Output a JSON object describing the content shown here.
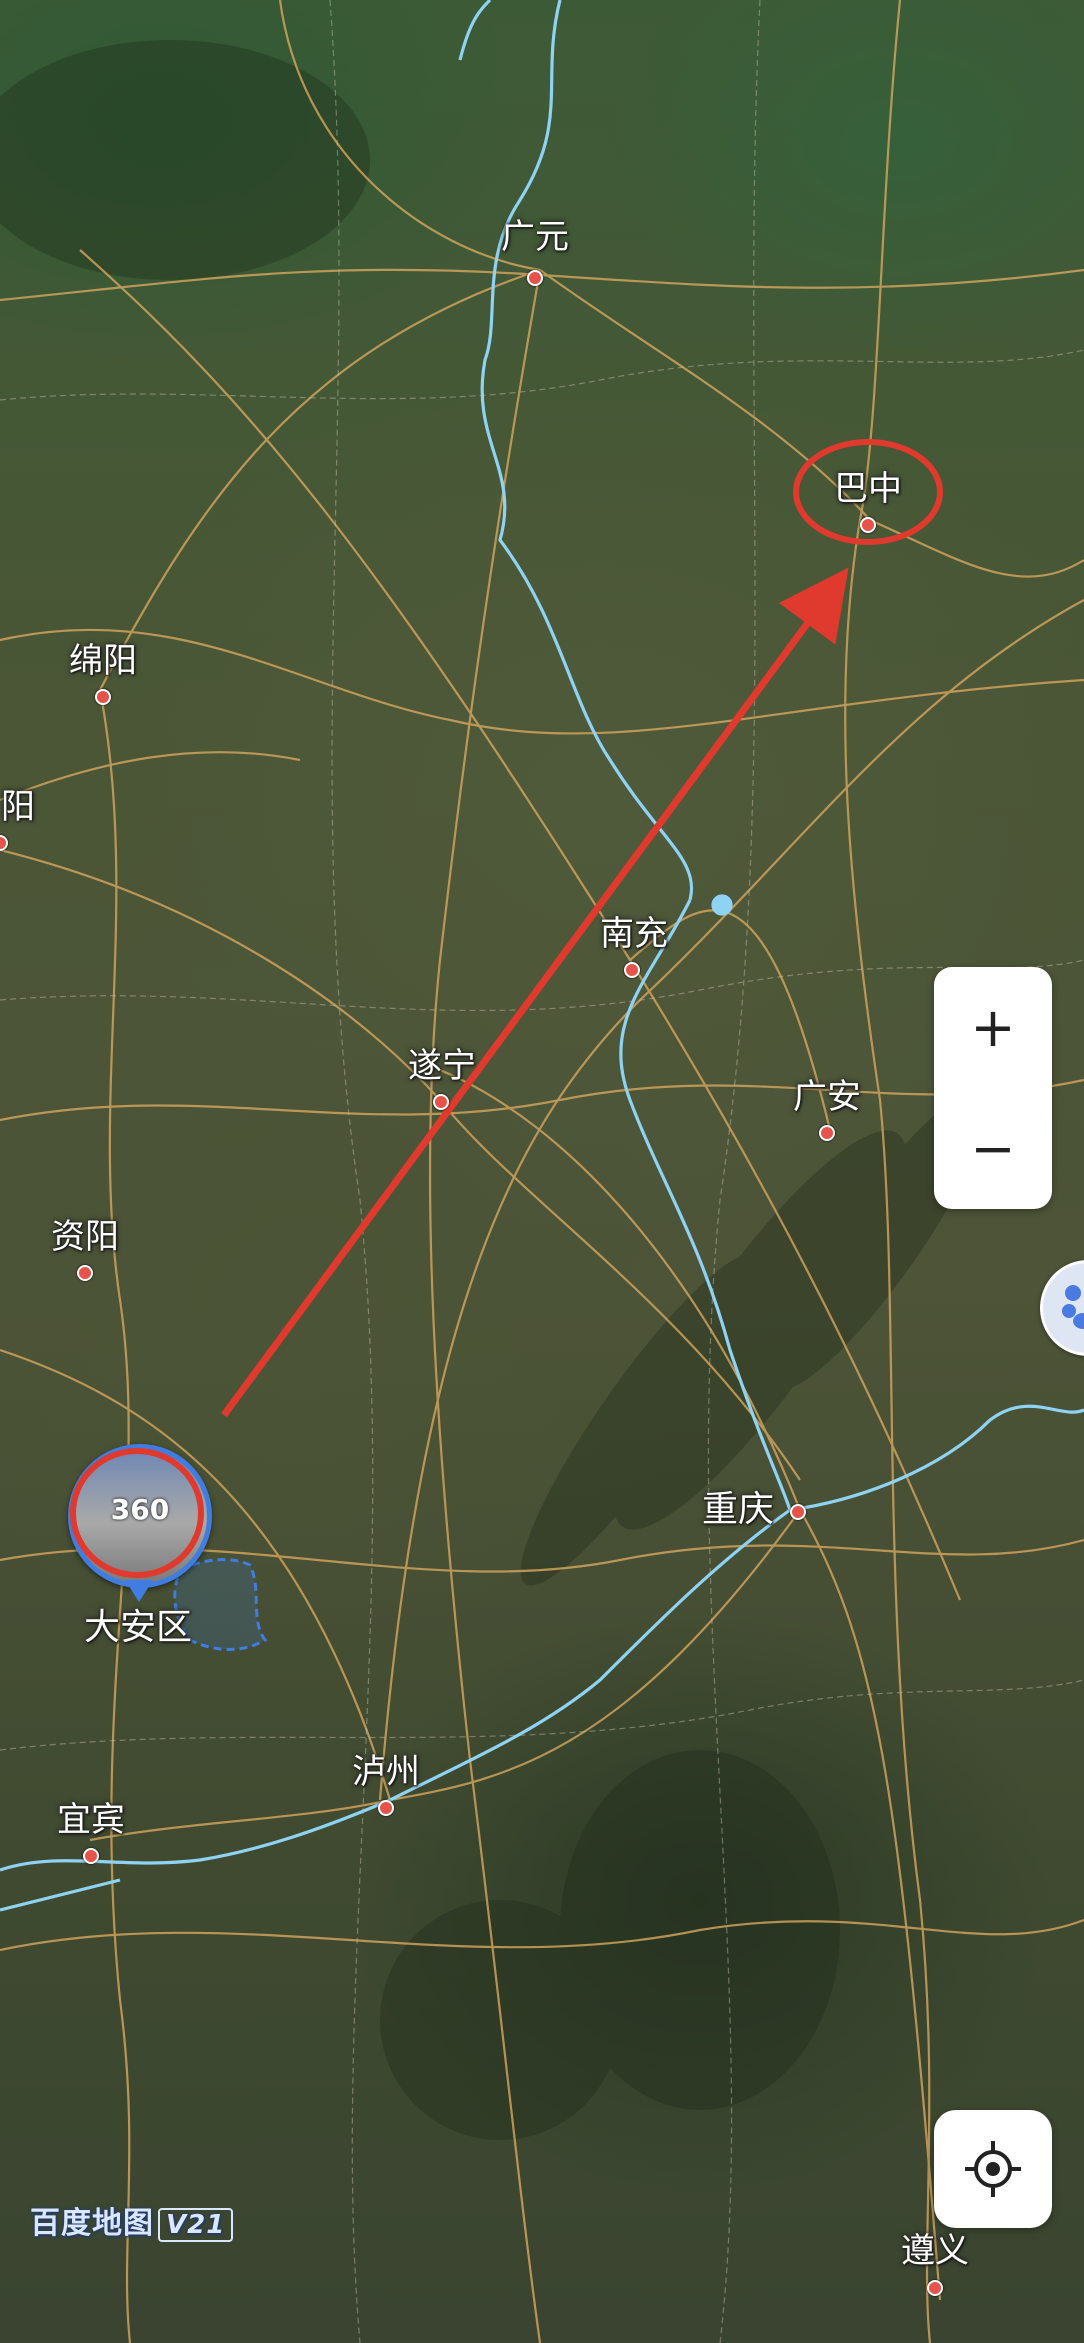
{
  "map": {
    "type": "satellite",
    "cities": [
      {
        "id": "guangyuan",
        "name": "广元"
      },
      {
        "id": "bazhong",
        "name": "巴中"
      },
      {
        "id": "mianyang",
        "name": "绵阳"
      },
      {
        "id": "deyang_partial",
        "name": "阳"
      },
      {
        "id": "nanchong",
        "name": "南充"
      },
      {
        "id": "suining",
        "name": "遂宁"
      },
      {
        "id": "guangan",
        "name": "广安"
      },
      {
        "id": "ziyang",
        "name": "资阳"
      },
      {
        "id": "chongqing",
        "name": "重庆"
      },
      {
        "id": "daan",
        "name": "大安区"
      },
      {
        "id": "luzhou",
        "name": "泸州"
      },
      {
        "id": "yibin",
        "name": "宜宾"
      },
      {
        "id": "zunyi",
        "name": "遵义"
      }
    ],
    "annotations": {
      "arrow_color": "#e03a2f",
      "circle_color": "#e03a2f",
      "arrow": {
        "from": "daan",
        "to": "bazhong"
      },
      "circled": [
        "bazhong",
        "daan"
      ]
    },
    "river_color": "#8fd3f4",
    "road_color": "#d8a860"
  },
  "controls": {
    "zoom_in_label": "+",
    "zoom_out_label": "−",
    "locate_icon": "crosshair-icon",
    "panorama_label": "360",
    "district_boundary_color": "#3f7de0"
  },
  "brand": {
    "name": "百度地图",
    "version": "V21"
  }
}
